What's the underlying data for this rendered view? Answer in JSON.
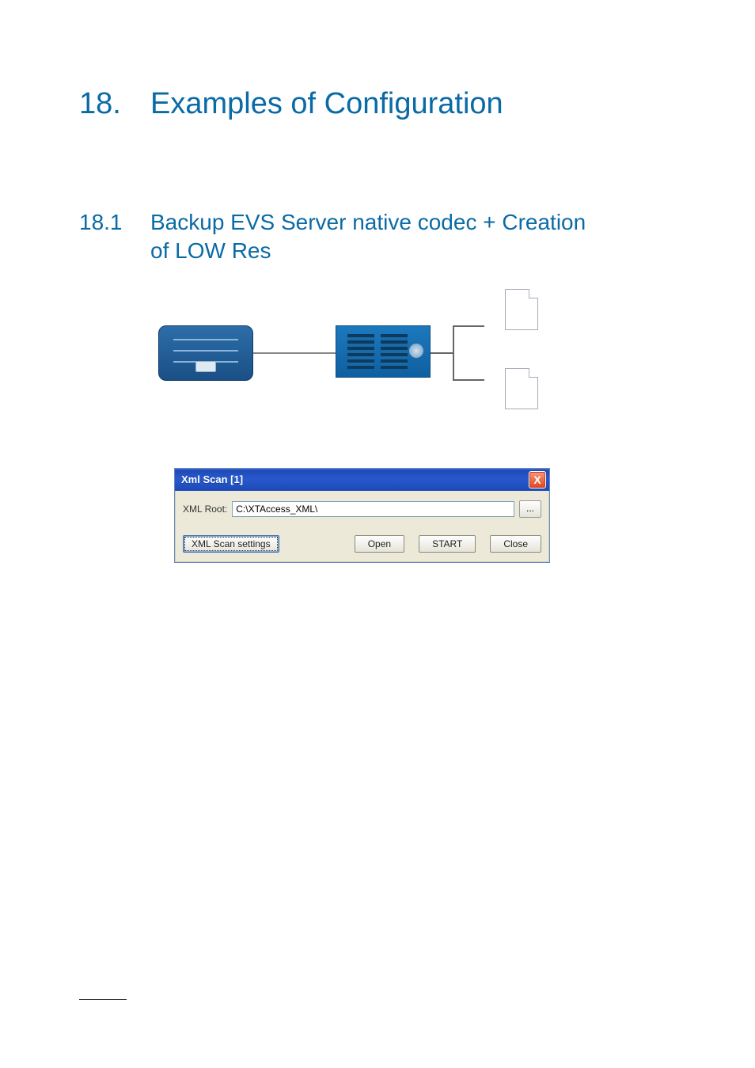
{
  "heading1": {
    "number": "18.",
    "text": "Examples of Configuration"
  },
  "heading2": {
    "number": "18.1",
    "text": "Backup EVS Server native codec + Creation of LOW Res"
  },
  "dialog": {
    "title": "Xml Scan [1]",
    "close_label": "X",
    "xml_root_label": "XML Root:",
    "xml_root_value": "C:\\XTAccess_XML\\",
    "browse_label": "...",
    "buttons": {
      "settings": "XML Scan settings",
      "open": "Open",
      "start": "START",
      "close": "Close"
    }
  }
}
